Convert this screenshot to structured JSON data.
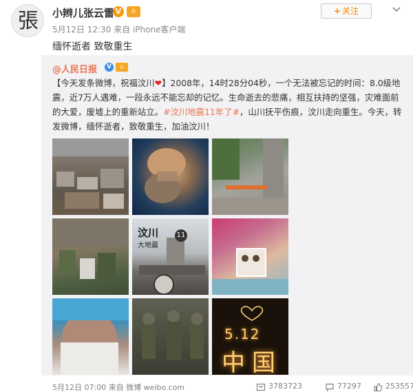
{
  "post": {
    "avatar_char": "張",
    "user_name": "小辫儿张云雷",
    "verified_badge": "V",
    "level_badge": "♔",
    "meta": "5月12日 12:30 来自 iPhone客户端",
    "follow_label": "关注",
    "follow_plus": "+",
    "text": "缅怀逝者 致敬重生"
  },
  "retweet": {
    "author": "@人民日报",
    "verified_badge": "V",
    "level_badge": "♔",
    "text_part1": "【今天发条微博，祝福汶川",
    "heart": "❤",
    "text_part2": "】2008年，14时28分04秒，一个无法被忘记的时间：8.0级地震，近7万人遇难，一段永远不能忘却的记忆。生命逝去的悲痛，相互扶持的坚强，灾难面前的大爱，废墟上的重新站立。",
    "hashtag": "#汶川地震11年了#",
    "text_part3": "，山川抚平伤痕，汶川走向重生。今天，转发微博，缅怀逝者，致敬重生，加油汶川！",
    "photo5_title": "汶川",
    "photo5_subtitle": "大地震",
    "photo5_number": "11",
    "photo9_line1": "5.12",
    "photo9_line2": "中国",
    "footer_meta": "5月12日 07:00 来自 微博 weibo.com",
    "reposts": "3783723",
    "comments": "77297",
    "likes": "253557"
  },
  "colors": {
    "accent_orange": "#ff8200",
    "link_orange": "#eb7350",
    "retweet_bg": "#f2f2f5"
  },
  "icons": [
    "chevron-down-icon",
    "repost-icon",
    "comment-icon",
    "like-icon",
    "heart-emoji-icon"
  ]
}
